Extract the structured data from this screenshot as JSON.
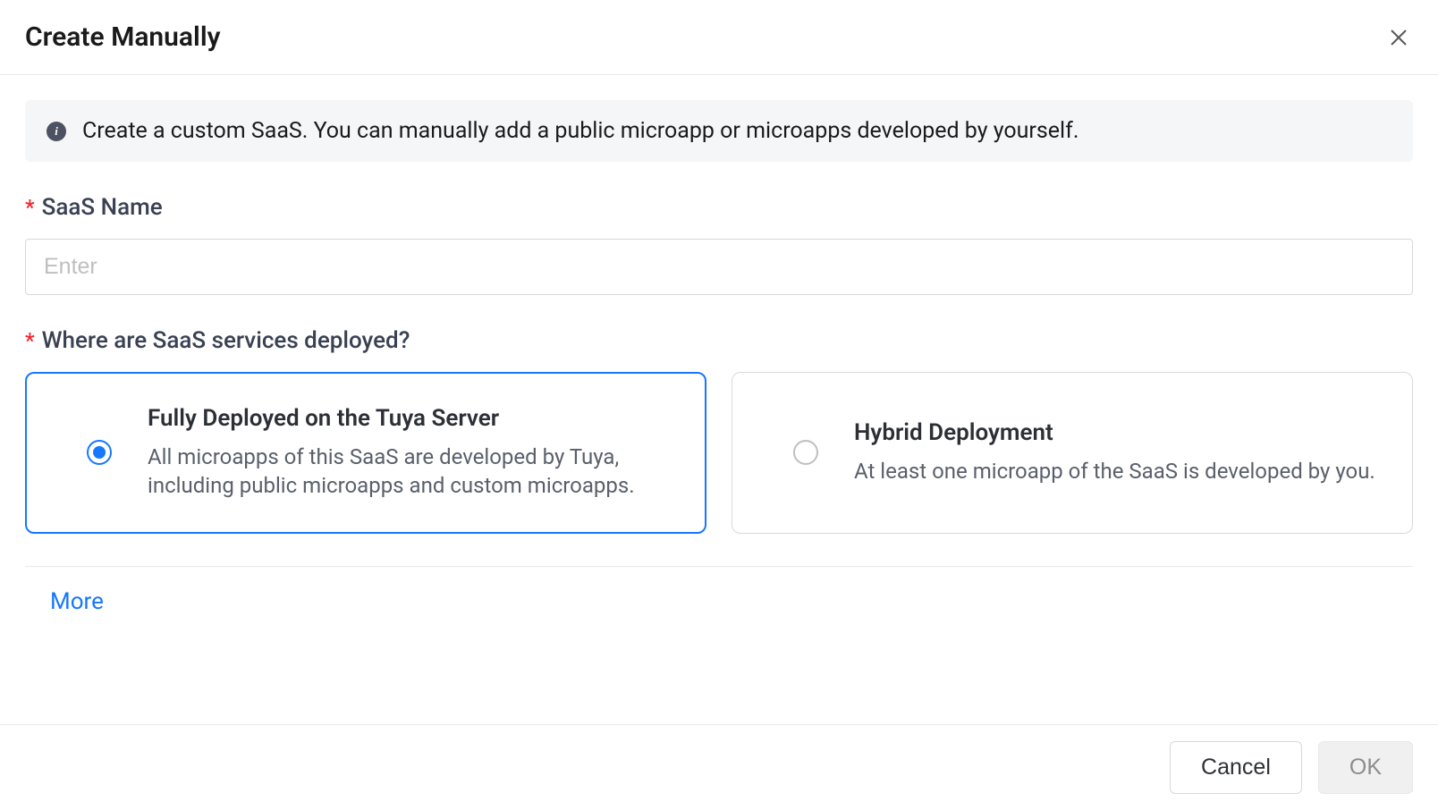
{
  "modal": {
    "title": "Create Manually",
    "info_text": "Create a custom SaaS. You can manually add a public microapp or microapps developed by yourself.",
    "fields": {
      "saas_name": {
        "label": "SaaS Name",
        "placeholder": "Enter",
        "value": ""
      },
      "deployment": {
        "label": "Where are SaaS services deployed?",
        "options": [
          {
            "title": "Fully Deployed on the Tuya Server",
            "desc": "All microapps of this SaaS are developed by Tuya, including public microapps and custom microapps.",
            "selected": true
          },
          {
            "title": "Hybrid Deployment",
            "desc": "At least one microapp of the SaaS is developed by you.",
            "selected": false
          }
        ]
      }
    },
    "more_label": "More",
    "cancel_label": "Cancel",
    "ok_label": "OK"
  }
}
